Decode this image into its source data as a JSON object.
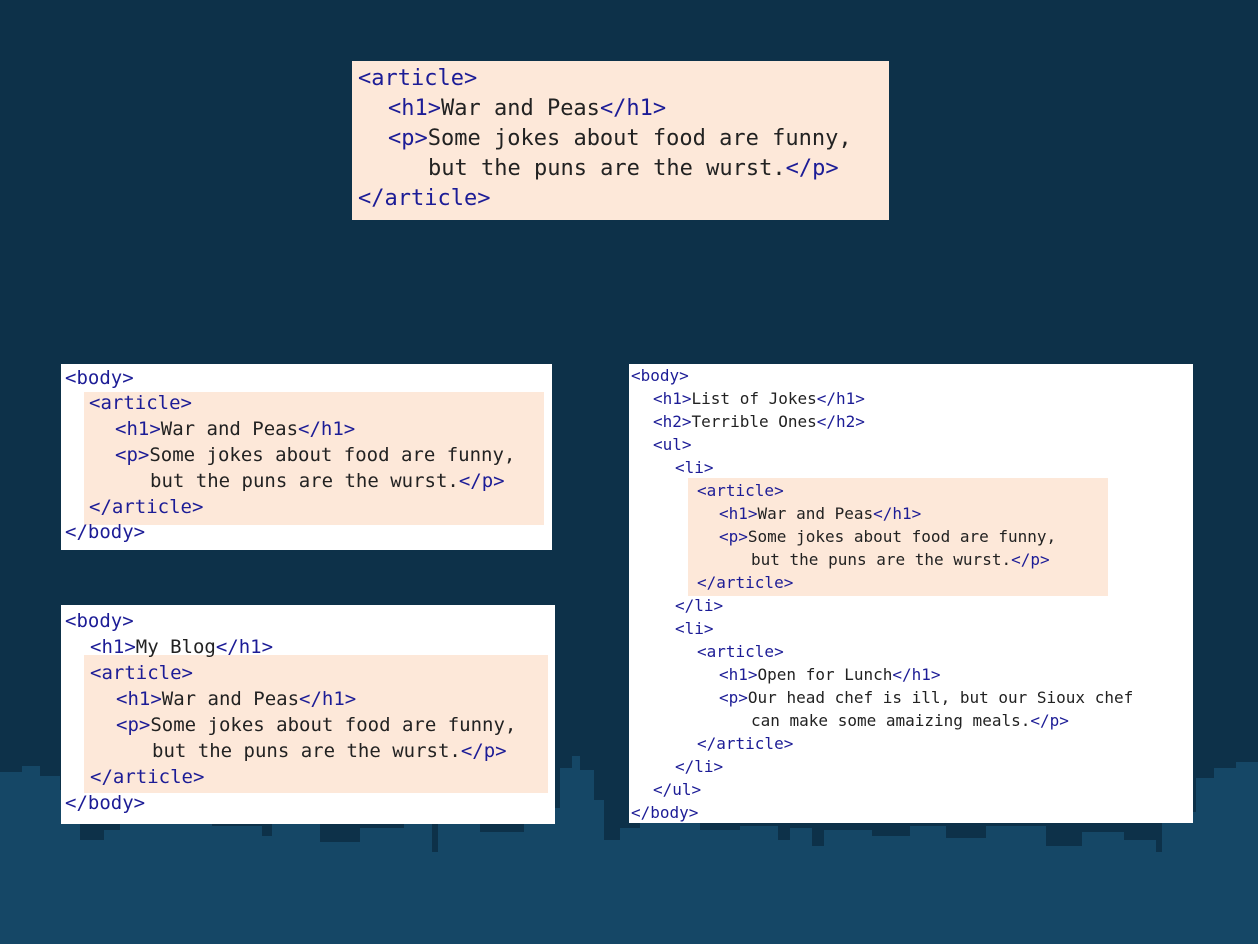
{
  "snippets": {
    "top": {
      "lines": [
        [
          {
            "t": "tag",
            "v": "<article>"
          }
        ],
        [
          {
            "t": "tag",
            "v": "<h1>"
          },
          {
            "t": "txt",
            "v": "War and Peas"
          },
          {
            "t": "tag",
            "v": "</h1>"
          }
        ],
        [
          {
            "t": "tag",
            "v": "<p>"
          },
          {
            "t": "txt",
            "v": "Some jokes about food are funny,"
          }
        ],
        [
          {
            "t": "txt",
            "v": "but the puns are the wurst."
          },
          {
            "t": "tag",
            "v": "</p>"
          }
        ],
        [
          {
            "t": "tag",
            "v": "</article>"
          }
        ]
      ]
    },
    "left_a": {
      "lines": [
        [
          {
            "t": "tag",
            "v": "<body>"
          }
        ],
        [
          {
            "t": "tag",
            "v": "<article>"
          }
        ],
        [
          {
            "t": "tag",
            "v": "<h1>"
          },
          {
            "t": "txt",
            "v": "War and Peas"
          },
          {
            "t": "tag",
            "v": "</h1>"
          }
        ],
        [
          {
            "t": "tag",
            "v": "<p>"
          },
          {
            "t": "txt",
            "v": "Some jokes about food are funny,"
          }
        ],
        [
          {
            "t": "txt",
            "v": "but the puns are the wurst."
          },
          {
            "t": "tag",
            "v": "</p>"
          }
        ],
        [
          {
            "t": "tag",
            "v": "</article>"
          }
        ],
        [
          {
            "t": "tag",
            "v": "</body>"
          }
        ]
      ]
    },
    "left_b": {
      "lines": [
        [
          {
            "t": "tag",
            "v": "<body>"
          }
        ],
        [
          {
            "t": "tag",
            "v": "<h1>"
          },
          {
            "t": "txt",
            "v": "My Blog"
          },
          {
            "t": "tag",
            "v": "</h1>"
          }
        ],
        [
          {
            "t": "tag",
            "v": "<article>"
          }
        ],
        [
          {
            "t": "tag",
            "v": "<h1>"
          },
          {
            "t": "txt",
            "v": "War and Peas"
          },
          {
            "t": "tag",
            "v": "</h1>"
          }
        ],
        [
          {
            "t": "tag",
            "v": "<p>"
          },
          {
            "t": "txt",
            "v": "Some jokes about food are funny,"
          }
        ],
        [
          {
            "t": "txt",
            "v": "but the puns are the wurst."
          },
          {
            "t": "tag",
            "v": "</p>"
          }
        ],
        [
          {
            "t": "tag",
            "v": "</article>"
          }
        ],
        [
          {
            "t": "tag",
            "v": "</body>"
          }
        ]
      ]
    },
    "right": {
      "lines": [
        [
          {
            "t": "tag",
            "v": "<body>"
          }
        ],
        [
          {
            "t": "tag",
            "v": "<h1>"
          },
          {
            "t": "txt",
            "v": "List of Jokes"
          },
          {
            "t": "tag",
            "v": "</h1>"
          }
        ],
        [
          {
            "t": "tag",
            "v": "<h2>"
          },
          {
            "t": "txt",
            "v": "Terrible Ones"
          },
          {
            "t": "tag",
            "v": "</h2>"
          }
        ],
        [
          {
            "t": "tag",
            "v": "<ul>"
          }
        ],
        [
          {
            "t": "tag",
            "v": "<li>"
          }
        ],
        [
          {
            "t": "tag",
            "v": "<article>"
          }
        ],
        [
          {
            "t": "tag",
            "v": "<h1>"
          },
          {
            "t": "txt",
            "v": "War and Peas"
          },
          {
            "t": "tag",
            "v": "</h1>"
          }
        ],
        [
          {
            "t": "tag",
            "v": "<p>"
          },
          {
            "t": "txt",
            "v": "Some jokes about food are funny,"
          }
        ],
        [
          {
            "t": "txt",
            "v": "but the puns are the wurst."
          },
          {
            "t": "tag",
            "v": "</p>"
          }
        ],
        [
          {
            "t": "tag",
            "v": "</article>"
          }
        ],
        [
          {
            "t": "tag",
            "v": "</li>"
          }
        ],
        [
          {
            "t": "tag",
            "v": "<li>"
          }
        ],
        [
          {
            "t": "tag",
            "v": "<article>"
          }
        ],
        [
          {
            "t": "tag",
            "v": "<h1>"
          },
          {
            "t": "txt",
            "v": "Open for Lunch"
          },
          {
            "t": "tag",
            "v": "</h1>"
          }
        ],
        [
          {
            "t": "tag",
            "v": "<p>"
          },
          {
            "t": "txt",
            "v": "Our head chef is ill, but our Sioux chef"
          }
        ],
        [
          {
            "t": "txt",
            "v": "can make some amaizing meals."
          },
          {
            "t": "tag",
            "v": "</p>"
          }
        ],
        [
          {
            "t": "tag",
            "v": "</article>"
          }
        ],
        [
          {
            "t": "tag",
            "v": "</li>"
          }
        ],
        [
          {
            "t": "tag",
            "v": "</ul>"
          }
        ],
        [
          {
            "t": "tag",
            "v": "</body>"
          }
        ]
      ]
    }
  },
  "colors": {
    "background": "#0d3149",
    "skyline": "#154766",
    "panel": "#ffffff",
    "highlight": "#fde8d9",
    "tag": "#1c1c96",
    "text": "#222222"
  }
}
